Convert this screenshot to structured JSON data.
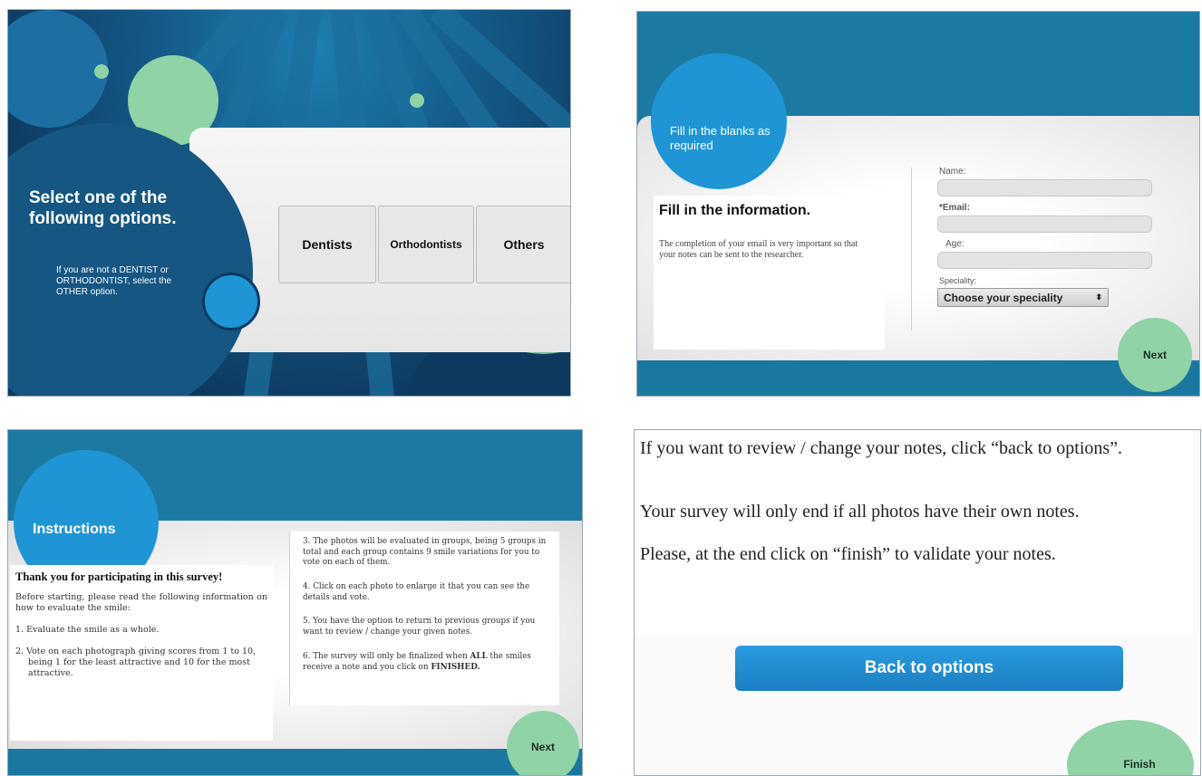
{
  "panel1": {
    "title": "Select one of the following options.",
    "note": "If you are not a DENTIST or ORTHODONTIST, select the OTHER option.",
    "options": [
      "Dentists",
      "Orthodontists",
      "Others"
    ]
  },
  "panel2": {
    "bubble_text": "Fill in the blanks as required",
    "heading": "Fill in the information.",
    "description": "The completion of your email is very important so that your notes can be sent to the researcher.",
    "fields": {
      "name_label": "Name:",
      "email_label": "*Email:",
      "age_label": "Age:",
      "speciality_label": "Speciality:"
    },
    "speciality_select": "Choose your speciality",
    "next_label": "Next"
  },
  "panel3": {
    "title": "Instructions",
    "heading": "Thank you for participating in this survey!",
    "intro": "Before starting, please read the following information on how to evaluate the smile:",
    "item1": "1.  Evaluate the smile as a whole.",
    "item2": "2.  Vote on each photograph giving scores from 1 to 10, being 1 for the least attractive and 10 for the most attractive.",
    "item3": "3. The photos will be evaluated in groups, being 5 groups in total and each group contains 9 smile variations for you to vote on each of them.",
    "item4": "4. Click on each photo to enlarge it that you can see the details and vote.",
    "item5": "5. You have the option to return to previous groups if you want to review / change your given notes.",
    "item6_pre": "6. The survey will only be finalized when ",
    "item6_all": "ALL",
    "item6_mid": " the smiles receive a note and you click on ",
    "item6_finished": "FINISHED.",
    "next_label": "Next"
  },
  "panel4": {
    "line1": "If you want to review / change your notes, click “back to options”.",
    "line2": "Your survey will only end if all photos have their own notes.",
    "line3": "Please, at the end click on “finish” to validate your notes.",
    "back_label": "Back to options",
    "finish_label": "Finish"
  },
  "colors": {
    "dark_blue": "#0f3b5f",
    "teal_blue": "#1a78a0",
    "bright_blue": "#1f95d6",
    "mint_green": "#8fd3a6"
  }
}
